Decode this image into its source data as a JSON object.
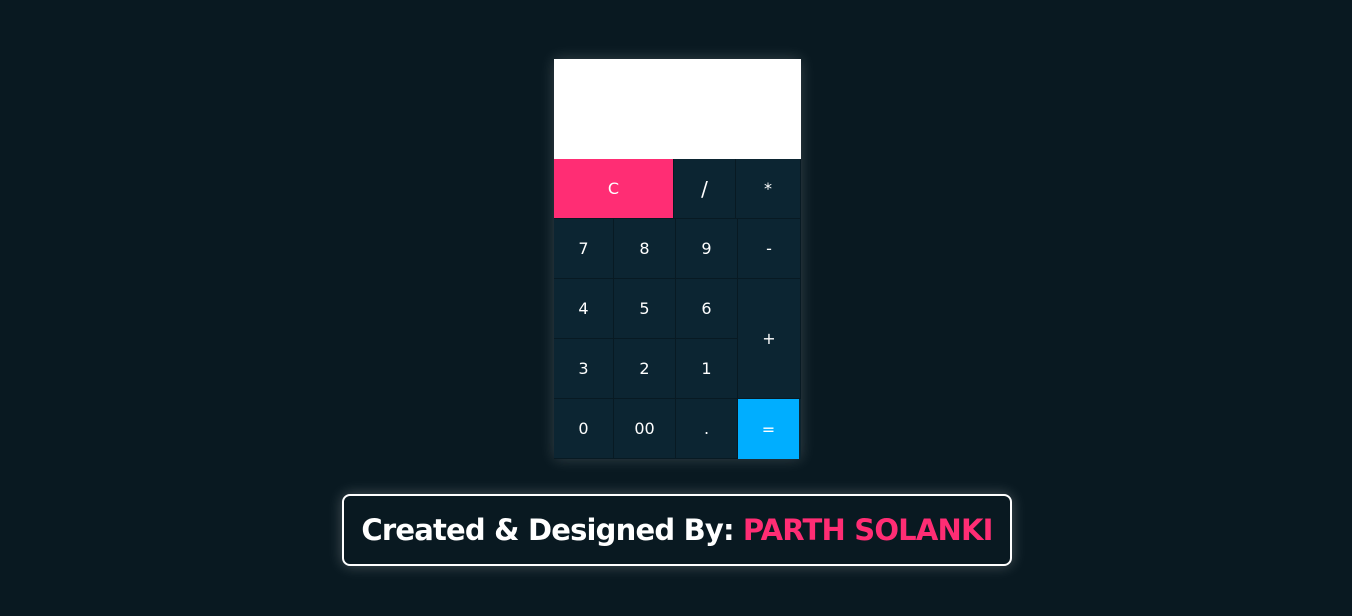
{
  "calculator": {
    "display_value": "",
    "keys": {
      "clear": "C",
      "divide": "/",
      "multiply": "*",
      "seven": "7",
      "eight": "8",
      "nine": "9",
      "subtract": "-",
      "four": "4",
      "five": "5",
      "six": "6",
      "add": "+",
      "three": "3",
      "two": "2",
      "one": "1",
      "zero": "0",
      "double_zero": "00",
      "decimal": ".",
      "equals": "="
    }
  },
  "credit": {
    "label": "Created & Designed By:",
    "author": "PARTH SOLANKI"
  },
  "colors": {
    "background": "#091921",
    "key_background": "#0c2532",
    "clear_accent": "#ff2d74",
    "equals_accent": "#00aeff",
    "display_background": "#ffffff"
  }
}
